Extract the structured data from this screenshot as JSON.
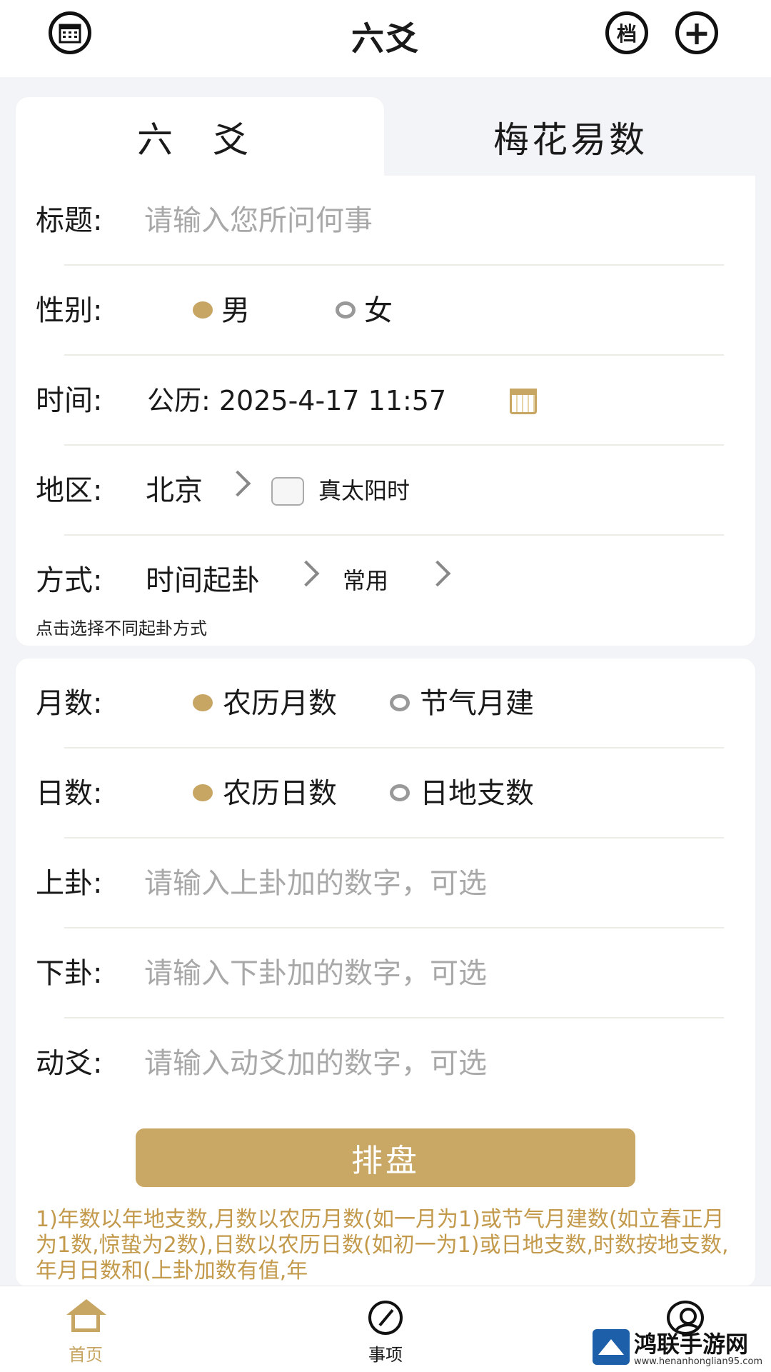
{
  "header": {
    "title": "六爻",
    "archive_label": "档",
    "add_label": "+",
    "calendar_icon": "calendar-icon"
  },
  "tabs": [
    {
      "label": "六 爻",
      "active": true
    },
    {
      "label": "梅花易数",
      "active": false
    }
  ],
  "form": {
    "title_label": "标题:",
    "title_placeholder": "请输入您所问何事",
    "gender_label": "性别:",
    "gender_options": [
      "男",
      "女"
    ],
    "gender_selected": "男",
    "time_label": "时间:",
    "time_value": "公历: 2025-4-17 11:57",
    "region_label": "地区:",
    "region_value": "北京",
    "solar_time_label": "真太阳时",
    "method_label": "方式:",
    "method_value": "时间起卦",
    "method_preset": "常用",
    "method_hint": "点击选择不同起卦方式"
  },
  "settings": {
    "month_label": "月数:",
    "month_options": [
      "农历月数",
      "节气月建"
    ],
    "day_label": "日数:",
    "day_options": [
      "农历日数",
      "日地支数"
    ],
    "upper_label": "上卦:",
    "upper_placeholder": "请输入上卦加的数字，可选",
    "lower_label": "下卦:",
    "lower_placeholder": "请输入下卦加的数字，可选",
    "moving_label": "动爻:",
    "moving_placeholder": "请输入动爻加的数字，可选",
    "submit_label": "排盘"
  },
  "notes": "1)年数以年地支数,月数以农历月数(如一月为1)或节气月建数(如立春正月为1数,惊蛰为2数),日数以农历日数(如初一为1)或日地支数,时数按地支数,年月日数和(上卦加数有值,年",
  "bottom_nav": [
    {
      "label": "首页",
      "active": true
    },
    {
      "label": "事项"
    },
    {
      "label": ""
    }
  ],
  "watermark": {
    "text": "鸿联手游网",
    "url": "www.henanhonglian95.com"
  },
  "colors": {
    "accent": "#c7a664",
    "notes": "#c39a4c"
  }
}
